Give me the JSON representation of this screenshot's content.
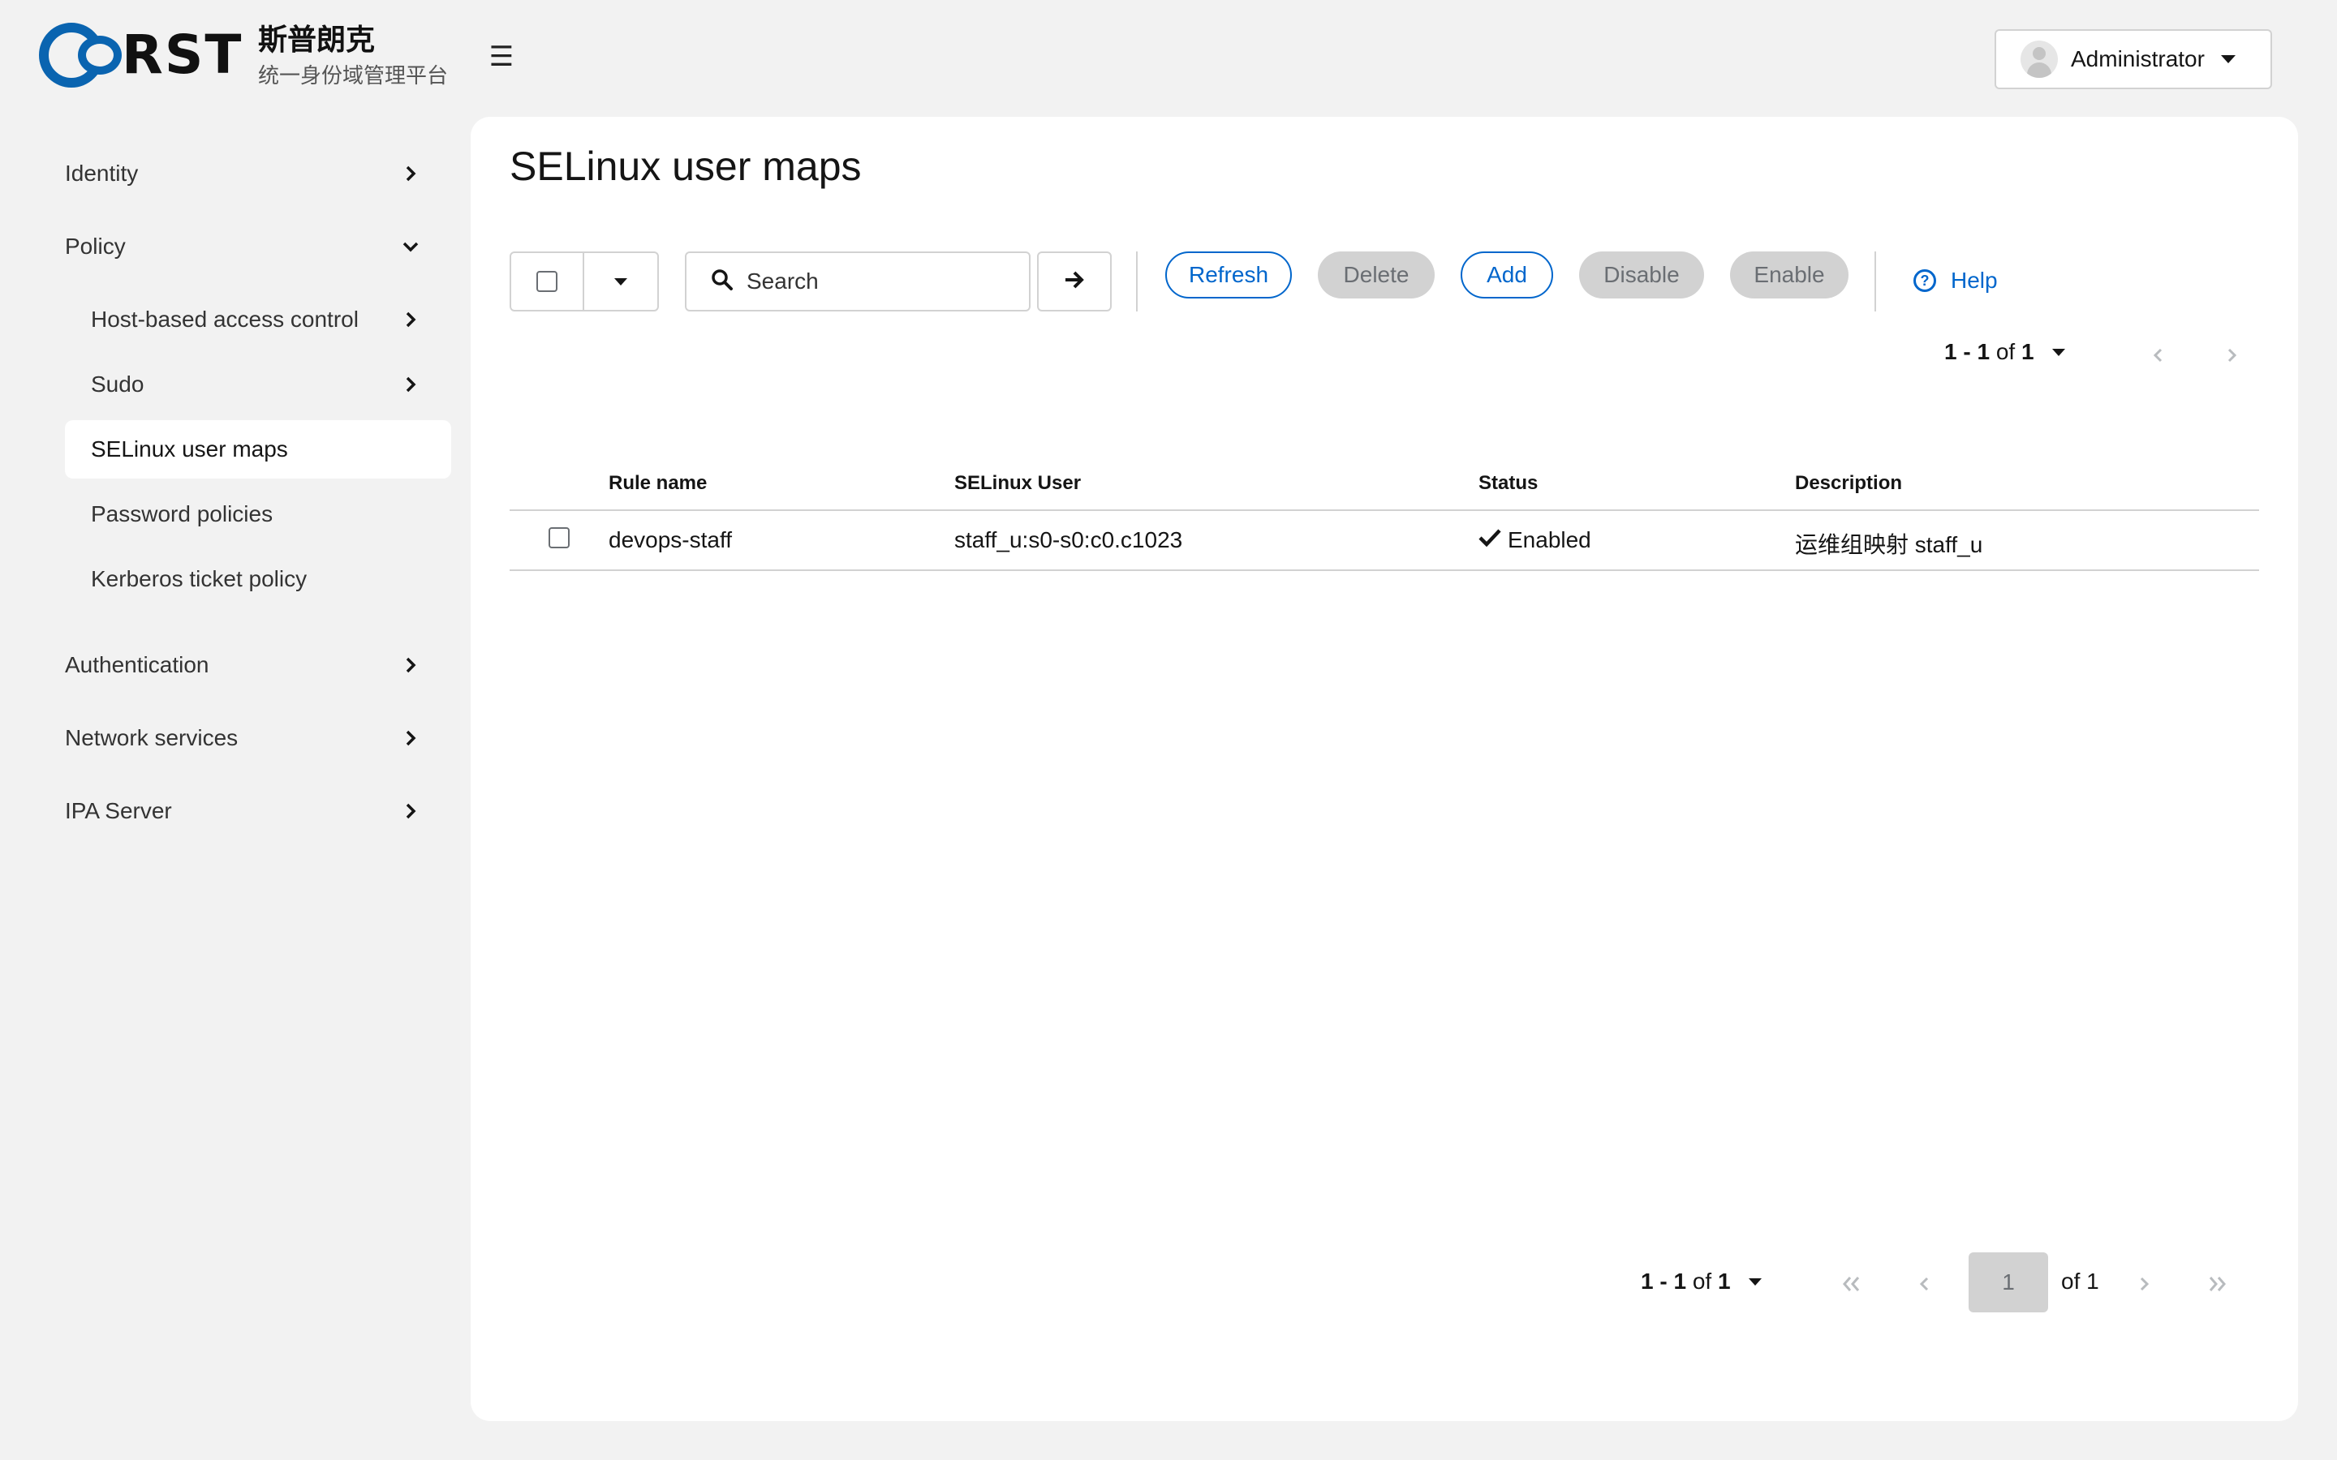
{
  "brand": {
    "logo_text": "RST",
    "name": "斯普朗克",
    "subtitle": "统一身份域管理平台"
  },
  "header": {
    "menu_toggle": "☰",
    "user": "Administrator"
  },
  "sidebar": {
    "sections": [
      {
        "label": "Identity",
        "expanded": false
      },
      {
        "label": "Policy",
        "expanded": true
      },
      {
        "label": "Authentication",
        "expanded": false
      },
      {
        "label": "Network services",
        "expanded": false
      },
      {
        "label": "IPA Server",
        "expanded": false
      }
    ],
    "policy_items": [
      {
        "label": "Host-based access control",
        "has_children": true
      },
      {
        "label": "Sudo",
        "has_children": true
      },
      {
        "label": "SELinux user maps",
        "active": true
      },
      {
        "label": "Password policies"
      },
      {
        "label": "Kerberos ticket policy"
      }
    ]
  },
  "main": {
    "title": "SELinux user maps",
    "search": {
      "placeholder": "Search",
      "value": ""
    },
    "actions": {
      "refresh": "Refresh",
      "delete": "Delete",
      "add": "Add",
      "disable": "Disable",
      "enable": "Enable",
      "help": "Help"
    },
    "pagination": {
      "range_start": "1",
      "range_end": "1",
      "of_word": "of",
      "total": "1",
      "current_page": "1",
      "page_count_text": "of 1"
    },
    "table": {
      "columns": [
        "Rule name",
        "SELinux User",
        "Status",
        "Description"
      ],
      "rows": [
        {
          "rule_name": "devops-staff",
          "selinux_user": "staff_u:s0-s0:c0.c1023",
          "status": "Enabled",
          "description": "运维组映射 staff_u"
        }
      ]
    }
  },
  "colors": {
    "accent": "#0066cc",
    "brand_blue": "#0a64b0",
    "background": "#f2f2f2",
    "disabled": "#d2d2d2"
  }
}
